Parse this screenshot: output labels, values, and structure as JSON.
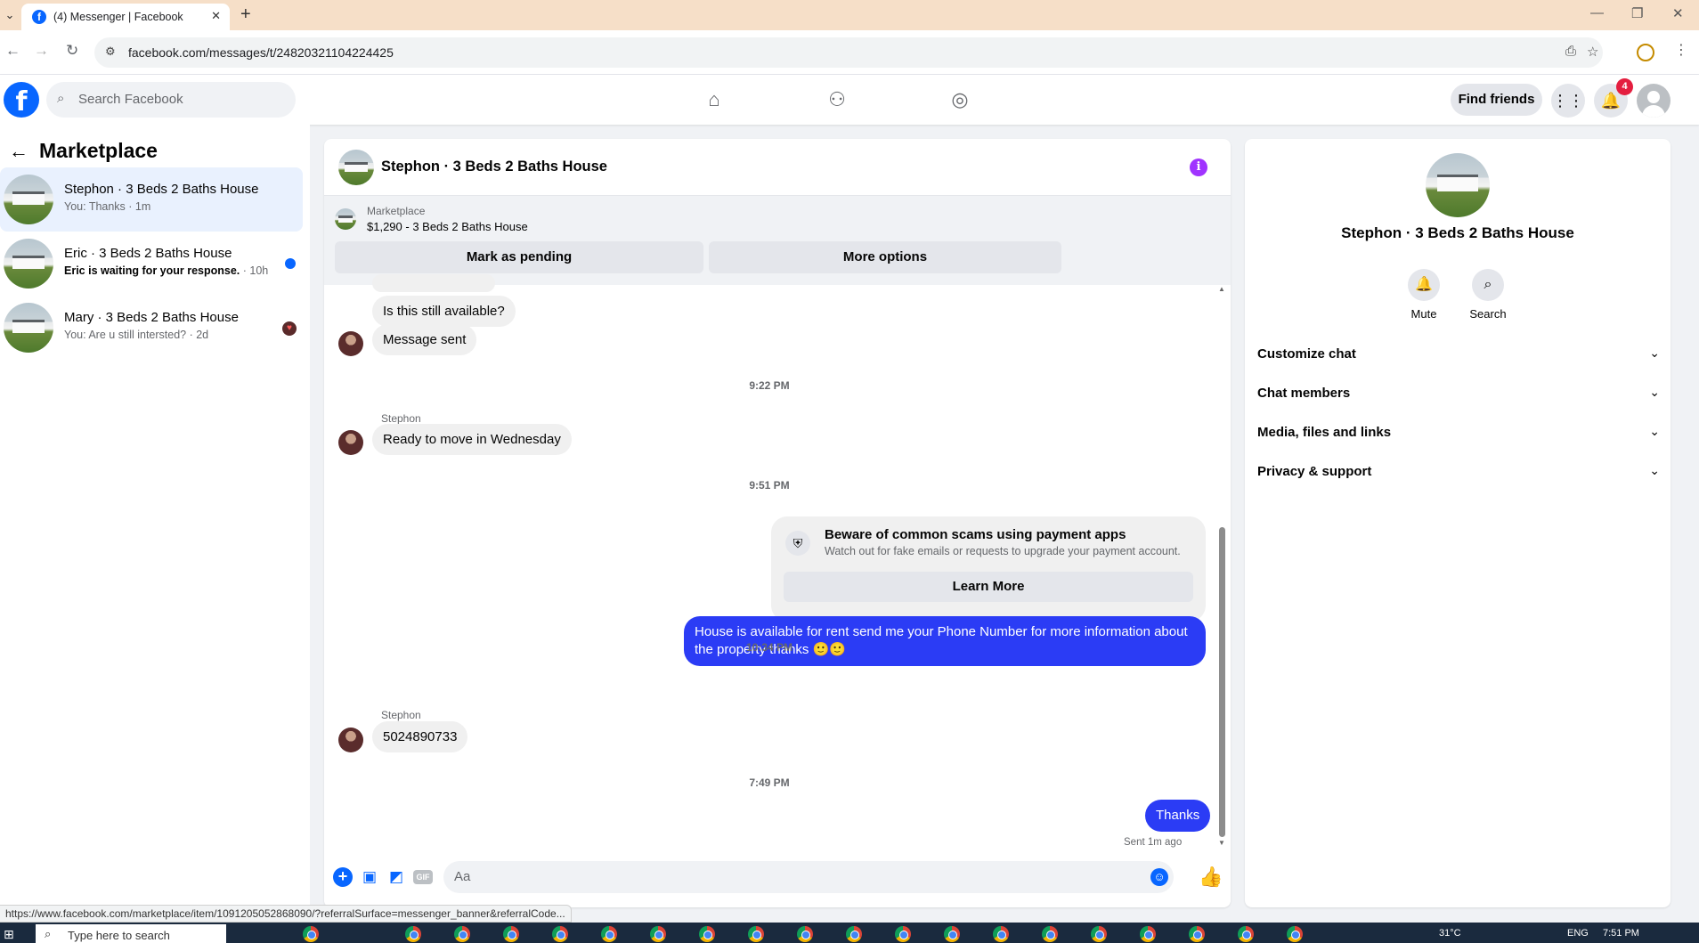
{
  "browser": {
    "tab_title": "(4) Messenger | Facebook",
    "url": "facebook.com/messages/t/24820321104224425",
    "status_url": "https://www.facebook.com/marketplace/item/1091205052868090/?referralSurface=messenger_banner&referralCode..."
  },
  "fb_header": {
    "search_placeholder": "Search Facebook",
    "find_friends": "Find friends",
    "notification_count": "4"
  },
  "sidebar": {
    "title": "Marketplace",
    "conversations": [
      {
        "name": "Stephon · 3 Beds 2 Baths House",
        "preview": "You: Thanks · 1m"
      },
      {
        "name": "Eric · 3 Beds 2 Baths House",
        "preview": "Eric is waiting for your response.",
        "time": " · 10h"
      },
      {
        "name": "Mary · 3 Beds 2 Baths House",
        "preview": "You: Are u still intersted? · 2d"
      }
    ]
  },
  "chat": {
    "title": "Stephon · 3 Beds 2 Baths House",
    "banner": {
      "label": "Marketplace",
      "price_line": "$1,290 - 3 Beds 2 Baths House",
      "mark_pending": "Mark as pending",
      "more_options": "More options"
    },
    "messages": {
      "m1": "Is this still available?",
      "m2": "Message sent",
      "ts1": "9:22 PM",
      "sender1": "Stephon",
      "m3": "Ready to move in Wednesday",
      "ts2": "9:51 PM",
      "scam_title": "Beware of common scams using payment apps",
      "scam_desc": "Watch out for fake emails or requests to upgrade your payment account.",
      "learn_more": "Learn More",
      "m4": "House is available for rent send me your Phone Number for more information about the property thanks 🙂🙂",
      "ts3": "10:34 PM",
      "sender2": "Stephon",
      "m5": "5024890733",
      "ts4": "7:49 PM",
      "m6": "Thanks",
      "sent_status": "Sent 1m ago"
    },
    "composer_placeholder": "Aa"
  },
  "right_panel": {
    "name": "Stephon · 3 Beds 2 Baths House",
    "mute": "Mute",
    "search": "Search",
    "sections": [
      "Customize chat",
      "Chat members",
      "Media, files and links",
      "Privacy & support"
    ]
  },
  "taskbar": {
    "search_placeholder": "Type here to search",
    "temp": "31°C",
    "lang": "ENG",
    "time": "7:51 PM"
  }
}
